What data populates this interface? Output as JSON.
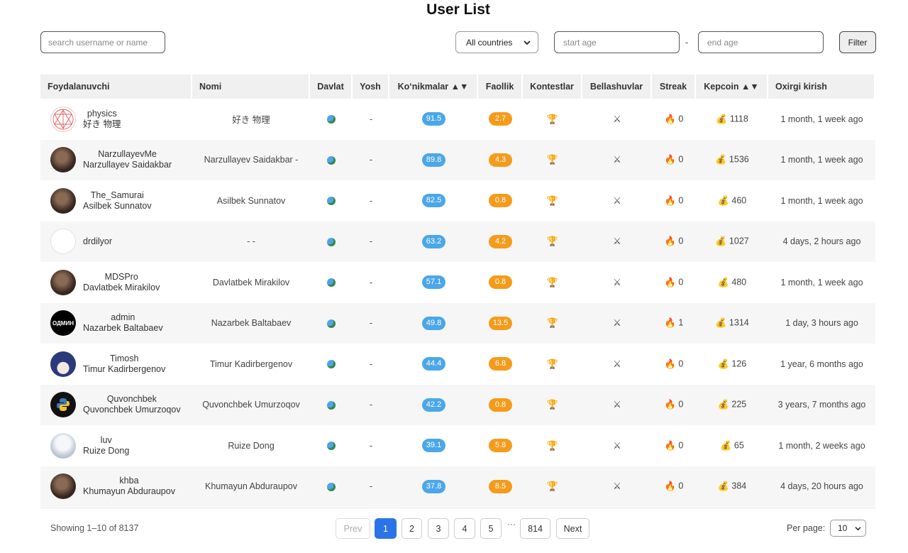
{
  "title": "User List",
  "filters": {
    "search_placeholder": "search username or name",
    "country_selected": "All countries",
    "start_age_placeholder": "start age",
    "age_separator": "-",
    "end_age_placeholder": "end age",
    "filter_label": "Filter"
  },
  "columns": {
    "user": "Foydalanuvchi",
    "name": "Nomi",
    "country": "Davlat",
    "age": "Yosh",
    "skills": "Ko‘nikmalar ▲▼",
    "activity": "Faollik",
    "contests": "Kontestlar",
    "battles": "Bellashuvlar",
    "streak": "Streak",
    "kepcoin": "Kepcoin ▲▼",
    "last_login": "Oxirgi kirish"
  },
  "rows": [
    {
      "username": "physics",
      "fullname": "好き 物理",
      "name": "好き 物理",
      "age": "-",
      "skills": "91.5",
      "activity": "2.7",
      "streak": "0",
      "kepcoin": "1118",
      "last_login": "1 month, 1 week ago",
      "avatar": "physics-avatar",
      "avatar_text": ""
    },
    {
      "username": "NarzullayevMe",
      "fullname": "Narzullayev Saidakbar",
      "name": "Narzullayev Saidakbar -",
      "age": "-",
      "skills": "89.8",
      "activity": "4.3",
      "streak": "0",
      "kepcoin": "1536",
      "last_login": "1 month, 1 week ago",
      "avatar": "photo-avatar",
      "avatar_text": ""
    },
    {
      "username": "The_Samurai",
      "fullname": "Asilbek Sunnatov",
      "name": "Asilbek Sunnatov",
      "age": "-",
      "skills": "82.5",
      "activity": "0.8",
      "streak": "0",
      "kepcoin": "460",
      "last_login": "1 month, 1 week ago",
      "avatar": "photo-avatar",
      "avatar_text": ""
    },
    {
      "username": "drdilyor",
      "fullname": "",
      "name": "- -",
      "age": "-",
      "skills": "63.2",
      "activity": "4.2",
      "streak": "0",
      "kepcoin": "1027",
      "last_login": "4 days, 2 hours ago",
      "avatar": "blank-avatar",
      "avatar_text": ""
    },
    {
      "username": "MDSPro",
      "fullname": "Davlatbek Mirakilov",
      "name": "Davlatbek Mirakilov",
      "age": "-",
      "skills": "57.1",
      "activity": "0.8",
      "streak": "0",
      "kepcoin": "480",
      "last_login": "1 month, 1 week ago",
      "avatar": "photo-avatar",
      "avatar_text": ""
    },
    {
      "username": "admin",
      "fullname": "Nazarbek Baltabaev",
      "name": "Nazarbek Baltabaev",
      "age": "-",
      "skills": "49.8",
      "activity": "13.5",
      "streak": "1",
      "kepcoin": "1314",
      "last_login": "1 day, 3 hours ago",
      "avatar": "text-avatar",
      "avatar_text": "ОДМИН"
    },
    {
      "username": "Timosh",
      "fullname": "Timur Kadirbergenov",
      "name": "Timur Kadirbergenov",
      "age": "-",
      "skills": "44.4",
      "activity": "6.8",
      "streak": "0",
      "kepcoin": "126",
      "last_login": "1 year, 6 months ago",
      "avatar": "anime-avatar",
      "avatar_text": ""
    },
    {
      "username": "Quvonchbek",
      "fullname": "Quvonchbek Umurzoqov",
      "name": "Quvonchbek Umurzoqov",
      "age": "-",
      "skills": "42.2",
      "activity": "0.8",
      "streak": "0",
      "kepcoin": "225",
      "last_login": "3 years, 7 months ago",
      "avatar": "python-avatar",
      "avatar_text": ""
    },
    {
      "username": "luv",
      "fullname": "Ruize Dong",
      "name": "Ruize Dong",
      "age": "-",
      "skills": "39.1",
      "activity": "5.8",
      "streak": "0",
      "kepcoin": "65",
      "last_login": "1 month, 2 weeks ago",
      "avatar": "sketch-avatar",
      "avatar_text": ""
    },
    {
      "username": "khba",
      "fullname": "Khumayun Abduraupov",
      "name": "Khumayun Abduraupov",
      "age": "-",
      "skills": "37.8",
      "activity": "8.5",
      "streak": "0",
      "kepcoin": "384",
      "last_login": "4 days, 20 hours ago",
      "avatar": "photo-avatar",
      "avatar_text": ""
    }
  ],
  "pagination": {
    "showing": "Showing 1–10 of 8137",
    "prev": "Prev",
    "pages": [
      "1",
      "2",
      "3",
      "4",
      "5"
    ],
    "ellipsis": "···",
    "last": "814",
    "next": "Next",
    "per_page_label": "Per page:",
    "per_page_value": "10"
  },
  "colors": {
    "skills_badge": "#4ba7e8",
    "activity_badge": "#f59b1b",
    "active_page": "#2a74e8"
  },
  "icons": {
    "country": "globe-icon",
    "contests": "trophy-icon",
    "battles": "crossed-swords-icon",
    "streak": "fire-icon",
    "kepcoin": "coin-bag-icon"
  }
}
